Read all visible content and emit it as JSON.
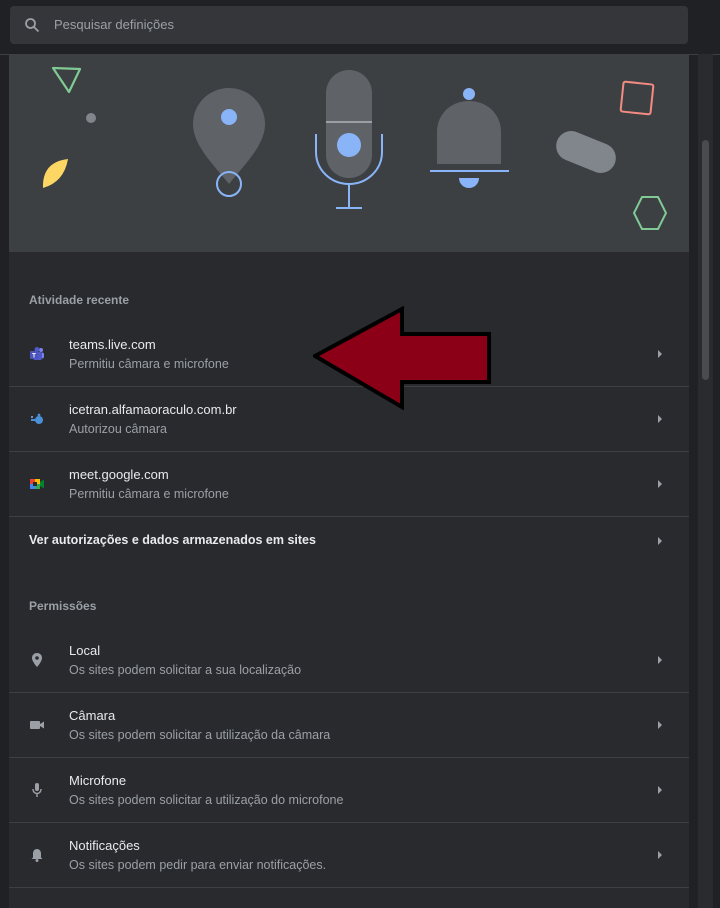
{
  "search": {
    "placeholder": "Pesquisar definições"
  },
  "recent": {
    "heading": "Atividade recente",
    "items": [
      {
        "title": "teams.live.com",
        "subtitle": "Permitiu câmara e microfone",
        "icon": "teams-icon"
      },
      {
        "title": "icetran.alfamaoraculo.com.br",
        "subtitle": "Autorizou câmara",
        "icon": "site-favicon"
      },
      {
        "title": "meet.google.com",
        "subtitle": "Permitiu câmara e microfone",
        "icon": "meet-icon"
      }
    ],
    "view_all": "Ver autorizações e dados armazenados em sites"
  },
  "permissions": {
    "heading": "Permissões",
    "items": [
      {
        "title": "Local",
        "subtitle": "Os sites podem solicitar a sua localização",
        "icon": "location-icon"
      },
      {
        "title": "Câmara",
        "subtitle": "Os sites podem solicitar a utilização da câmara",
        "icon": "camera-icon"
      },
      {
        "title": "Microfone",
        "subtitle": "Os sites podem solicitar a utilização do microfone",
        "icon": "microphone-icon"
      },
      {
        "title": "Notificações",
        "subtitle": "Os sites podem pedir para enviar notificações.",
        "icon": "bell-icon"
      }
    ]
  },
  "colors": {
    "background": "#202124",
    "card": "#292a2d",
    "banner": "#3c4043",
    "text_primary": "#e8eaed",
    "text_secondary": "#9aa0a6",
    "accent_blue": "#8ab4f8",
    "annotation_arrow": "#8b0016"
  }
}
